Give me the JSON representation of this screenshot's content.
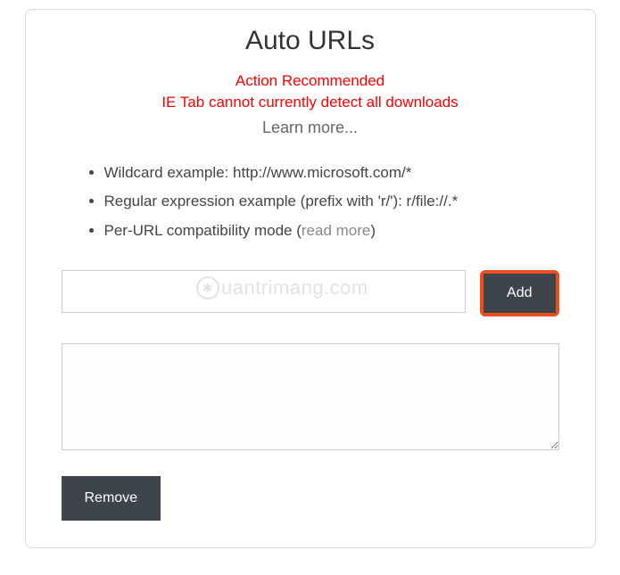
{
  "title": "Auto URLs",
  "warning": {
    "line1": "Action Recommended",
    "line2": "IE Tab cannot currently detect all downloads"
  },
  "learn_more": "Learn more...",
  "examples": {
    "wildcard": "Wildcard example: http://www.microsoft.com/*",
    "regex": "Regular expression example (prefix with 'r/'): r/file://.*",
    "perurl_prefix": "Per-URL compatibility mode (",
    "perurl_link": "read more",
    "perurl_suffix": ")"
  },
  "input": {
    "value": "",
    "placeholder": ""
  },
  "buttons": {
    "add": "Add",
    "remove": "Remove"
  },
  "url_list": "",
  "watermark": "uantrimang.com"
}
